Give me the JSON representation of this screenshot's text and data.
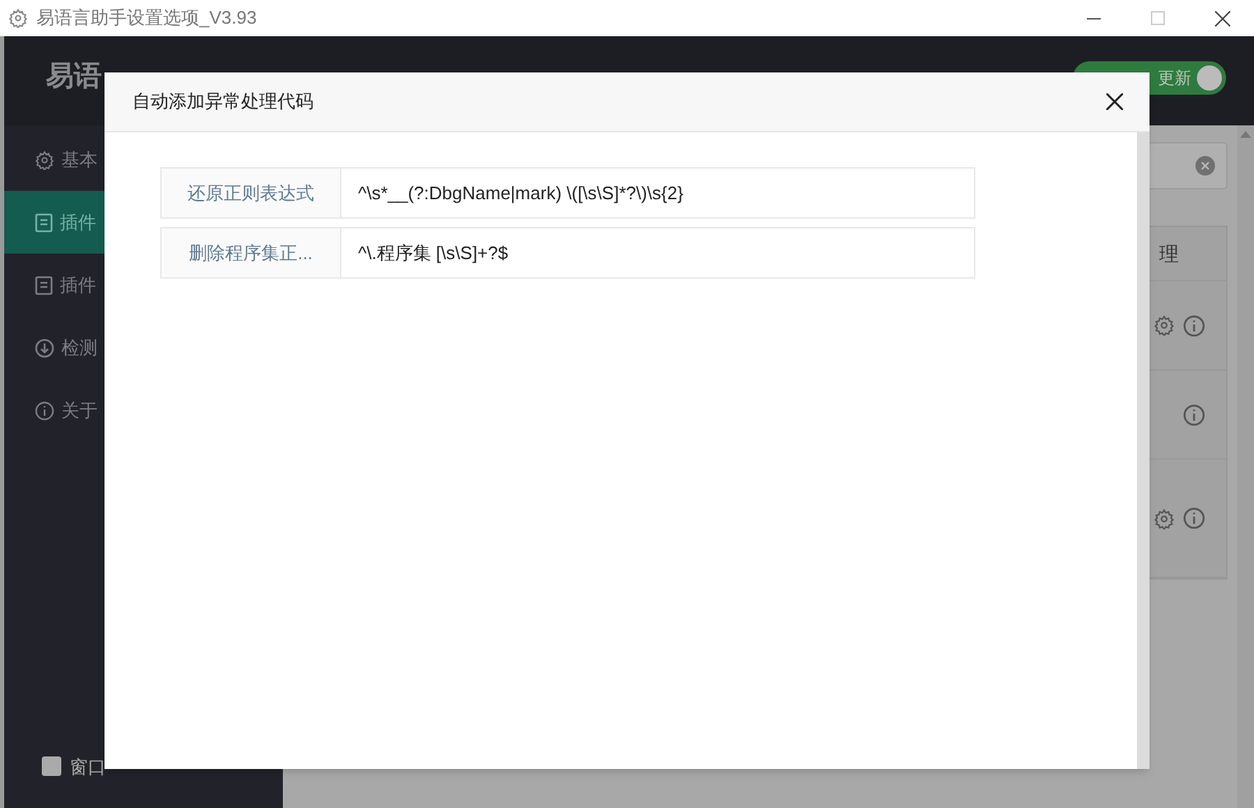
{
  "window": {
    "title": "易语言助手设置选项_V3.93"
  },
  "header": {
    "title": "易语",
    "update_toggle": {
      "label": "更新",
      "on": true
    }
  },
  "sidebar": {
    "items": [
      {
        "label": "基本",
        "selected": false
      },
      {
        "label": "插件",
        "selected": true
      },
      {
        "label": "插件",
        "selected": false
      },
      {
        "label": "检测",
        "selected": false
      },
      {
        "label": "关于",
        "selected": false
      }
    ],
    "pin_checkbox": {
      "label": "窗口",
      "checked": false
    }
  },
  "table": {
    "header": "理",
    "rows": [
      {
        "settings": true
      },
      {
        "settings": false
      },
      {
        "settings": true
      }
    ]
  },
  "dialog": {
    "title": "自动添加异常处理代码",
    "fields": [
      {
        "label": "还原正则表达式",
        "value": "^\\s*__(?:DbgName|mark) \\([\\s\\S]*?\\)\\s{2}"
      },
      {
        "label": "删除程序集正...",
        "value": "^\\.程序集 [\\s\\S]+?$"
      }
    ]
  }
}
